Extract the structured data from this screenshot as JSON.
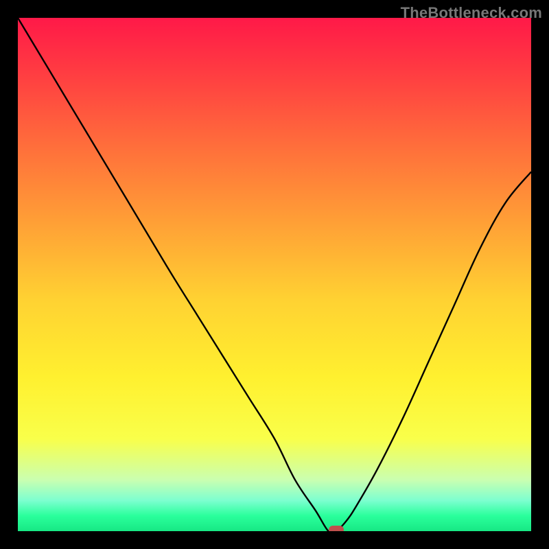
{
  "watermark": "TheBottleneck.com",
  "colors": {
    "frame": "#000000",
    "curve": "#000000",
    "marker": "#c0504d",
    "gradient_stops": [
      {
        "offset": 0.0,
        "color": "#ff1948"
      },
      {
        "offset": 0.1,
        "color": "#ff3a42"
      },
      {
        "offset": 0.25,
        "color": "#ff6e3b"
      },
      {
        "offset": 0.4,
        "color": "#ffa036"
      },
      {
        "offset": 0.55,
        "color": "#ffd232"
      },
      {
        "offset": 0.7,
        "color": "#fff02f"
      },
      {
        "offset": 0.82,
        "color": "#f9ff4a"
      },
      {
        "offset": 0.9,
        "color": "#caffb0"
      },
      {
        "offset": 0.94,
        "color": "#7dffd0"
      },
      {
        "offset": 0.97,
        "color": "#2aff9c"
      },
      {
        "offset": 1.0,
        "color": "#17e884"
      }
    ]
  },
  "chart_data": {
    "type": "line",
    "title": "",
    "xlabel": "",
    "ylabel": "",
    "xlim": [
      0,
      100
    ],
    "ylim": [
      0,
      100
    ],
    "grid": false,
    "legend": false,
    "x": [
      0,
      6,
      12,
      18,
      24,
      30,
      35,
      40,
      45,
      50,
      54,
      58,
      60.5,
      62,
      64,
      66,
      70,
      75,
      80,
      85,
      90,
      95,
      100
    ],
    "values": [
      100,
      90,
      80,
      70,
      60,
      50,
      42,
      34,
      26,
      18,
      10,
      4,
      0,
      0,
      2,
      5,
      12,
      22,
      33,
      44,
      55,
      64,
      70
    ],
    "marker": {
      "x": 62,
      "y": 0
    }
  }
}
